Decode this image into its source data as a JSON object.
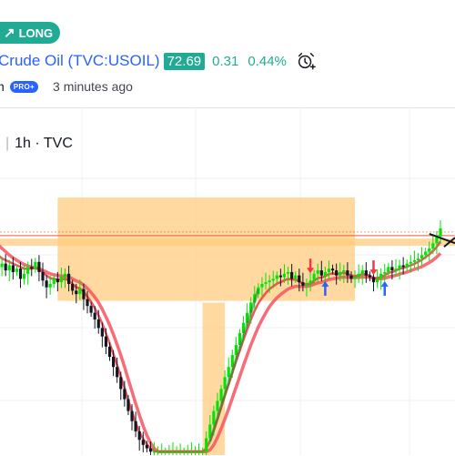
{
  "badge": {
    "label": "LONG",
    "icon": "arrow-up-right-icon"
  },
  "symbol": {
    "title": "Crude Oil (TVC:USOIL)",
    "price": "72.69",
    "change": "0.31",
    "change_pct": "0.44%",
    "alert_icon": "alarm-clock-plus-icon"
  },
  "author": {
    "name_tail": "n",
    "pro_badge": "PRO+",
    "time_ago": "3 minutes ago"
  },
  "chart_header": {
    "interval": "1h",
    "source": "TVC"
  },
  "colors": {
    "accent": "#22ab94",
    "link": "#2962ff",
    "zone": "#ffcc80",
    "ma_fast": "#f23645",
    "ma_slow": "#f7525f",
    "up_candle": "#00e600",
    "down_candle": "#131722",
    "price_line": "#e85d3a",
    "arrow_buy": "#2962ff",
    "arrow_sell": "#f23645"
  },
  "chart_data": {
    "type": "line",
    "title": "",
    "xlabel": "",
    "ylabel": "",
    "ylim": [
      66.0,
      73.6
    ],
    "grid": true,
    "x": [
      0,
      1,
      2,
      3,
      4,
      5,
      6,
      7,
      8,
      9,
      10,
      11,
      12,
      13,
      14,
      15,
      16,
      17,
      18,
      19,
      20,
      21,
      22,
      23,
      24,
      25,
      26,
      27,
      28,
      29,
      30,
      31,
      32,
      33,
      34,
      35,
      36,
      37,
      38,
      39,
      40,
      41,
      42,
      43,
      44,
      45,
      46,
      47,
      48,
      49,
      50,
      51,
      52,
      53,
      54,
      55,
      56,
      57,
      58,
      59,
      60,
      61,
      62,
      63,
      64,
      65,
      66,
      67,
      68,
      69,
      70,
      71,
      72,
      73,
      74,
      75,
      76,
      77,
      78,
      79,
      80,
      81,
      82,
      83,
      84,
      85,
      86,
      87,
      88,
      89,
      90,
      91,
      92,
      93,
      94,
      95,
      96,
      97,
      98,
      99,
      100,
      101,
      102,
      103,
      104,
      105,
      106,
      107,
      108,
      109,
      110,
      111,
      112,
      113,
      114,
      115,
      116,
      117,
      118,
      119
    ],
    "series": [
      {
        "values": [
          71.55,
          71.65,
          71.45,
          71.6,
          71.4,
          71.5,
          71.2,
          71.35,
          71.55,
          71.5,
          71.7,
          71.4,
          71.15,
          70.95,
          71.05,
          71.2,
          71.1,
          71.25,
          71.35,
          71.05,
          70.85,
          70.75,
          70.9,
          70.6,
          70.4,
          70.2,
          70.0,
          69.75,
          69.5,
          69.2,
          68.9,
          68.6,
          68.3,
          67.95,
          67.65,
          67.3,
          67.0,
          66.7,
          66.45,
          66.3,
          66.2,
          66.1,
          66.1,
          66.1,
          66.1,
          66.1,
          66.1,
          66.1,
          66.1,
          66.1,
          66.1,
          66.1,
          66.1,
          66.1,
          66.1,
          66.1,
          66.5,
          66.9,
          67.3,
          67.6,
          67.95,
          68.3,
          68.6,
          68.95,
          69.25,
          69.6,
          69.9,
          70.2,
          70.5,
          70.75,
          70.95,
          71.05,
          71.1,
          71.15,
          71.2,
          71.3,
          71.25,
          71.35,
          71.4,
          71.2,
          71.3,
          71.1,
          71.0,
          71.05,
          71.15,
          71.35,
          71.45,
          71.3,
          71.4,
          71.5,
          71.45,
          71.3,
          71.4,
          71.45,
          71.3,
          71.2,
          71.25,
          71.35,
          71.45,
          71.3,
          71.25,
          71.1,
          71.2,
          71.35,
          71.4,
          71.55,
          71.45,
          71.5,
          71.6,
          71.55,
          71.65,
          71.7,
          71.75,
          71.8,
          71.9,
          72.0,
          72.1,
          72.25,
          72.45,
          72.69
        ]
      }
    ],
    "ma_fast": {
      "values": [
        71.9,
        71.8,
        71.75,
        71.7,
        71.65,
        71.6,
        71.55,
        71.5,
        71.5,
        71.5,
        71.52,
        71.48,
        71.4,
        71.3,
        71.22,
        71.2,
        71.18,
        71.18,
        71.2,
        71.15,
        71.05,
        70.95,
        70.92,
        70.82,
        70.68,
        70.52,
        70.34,
        70.12,
        69.88,
        69.6,
        69.3,
        68.98,
        68.66,
        68.32,
        67.98,
        67.62,
        67.28,
        66.95,
        66.68,
        66.48,
        66.32,
        66.2,
        66.12,
        66.1,
        66.1,
        66.1,
        66.1,
        66.1,
        66.1,
        66.1,
        66.1,
        66.1,
        66.1,
        66.1,
        66.1,
        66.1,
        66.2,
        66.42,
        66.72,
        67.05,
        67.4,
        67.75,
        68.08,
        68.42,
        68.76,
        69.08,
        69.4,
        69.7,
        70.0,
        70.26,
        70.48,
        70.64,
        70.78,
        70.9,
        70.98,
        71.06,
        71.1,
        71.16,
        71.2,
        71.18,
        71.18,
        71.12,
        71.06,
        71.04,
        71.06,
        71.14,
        71.22,
        71.24,
        71.28,
        71.34,
        71.36,
        71.34,
        71.36,
        71.38,
        71.34,
        71.3,
        71.28,
        71.3,
        71.34,
        71.32,
        71.3,
        71.22,
        71.22,
        71.26,
        71.3,
        71.38,
        71.4,
        71.44,
        71.5,
        71.52,
        71.56,
        71.6,
        71.64,
        71.7,
        71.76,
        71.84,
        71.92,
        72.02,
        72.14,
        72.3
      ]
    },
    "ma_slow": {
      "values": [
        72.2,
        72.1,
        72.0,
        71.9,
        71.82,
        71.75,
        71.68,
        71.62,
        71.58,
        71.55,
        71.53,
        71.5,
        71.45,
        71.4,
        71.35,
        71.32,
        71.3,
        71.28,
        71.28,
        71.26,
        71.2,
        71.14,
        71.1,
        71.02,
        70.92,
        70.8,
        70.66,
        70.5,
        70.3,
        70.08,
        69.84,
        69.56,
        69.26,
        68.94,
        68.6,
        68.24,
        67.88,
        67.52,
        67.18,
        66.86,
        66.58,
        66.36,
        66.2,
        66.1,
        66.1,
        66.1,
        66.1,
        66.1,
        66.1,
        66.1,
        66.1,
        66.1,
        66.1,
        66.1,
        66.1,
        66.1,
        66.1,
        66.15,
        66.3,
        66.52,
        66.78,
        67.06,
        67.36,
        67.68,
        68.0,
        68.32,
        68.64,
        68.95,
        69.25,
        69.52,
        69.78,
        70.0,
        70.2,
        70.38,
        70.52,
        70.64,
        70.74,
        70.82,
        70.9,
        70.94,
        70.98,
        70.98,
        70.98,
        70.98,
        71.0,
        71.04,
        71.08,
        71.1,
        71.14,
        71.18,
        71.2,
        71.22,
        71.24,
        71.25,
        71.25,
        71.24,
        71.24,
        71.24,
        71.25,
        71.25,
        71.25,
        71.22,
        71.2,
        71.2,
        71.22,
        71.25,
        71.28,
        71.3,
        71.34,
        71.37,
        71.4,
        71.44,
        71.48,
        71.52,
        71.56,
        71.62,
        71.68,
        71.75,
        71.84,
        71.95
      ]
    },
    "current_price": 72.69,
    "supply_zone": {
      "x_range": [
        16,
        96
      ],
      "y_range": [
        70.55,
        73.6
      ]
    },
    "target_level": {
      "x_range": [
        0,
        119
      ],
      "y": 72.28
    },
    "demand_zone": {
      "x_range": [
        55,
        61
      ],
      "y_range": [
        66.0,
        70.55
      ]
    },
    "signals": [
      {
        "type": "sell",
        "x": 84
      },
      {
        "type": "buy",
        "x": 88
      },
      {
        "type": "sell",
        "x": 101
      },
      {
        "type": "buy",
        "x": 104
      }
    ],
    "projection": {
      "from": [
        116,
        72.69
      ],
      "to": [
        124,
        72.2
      ]
    }
  }
}
